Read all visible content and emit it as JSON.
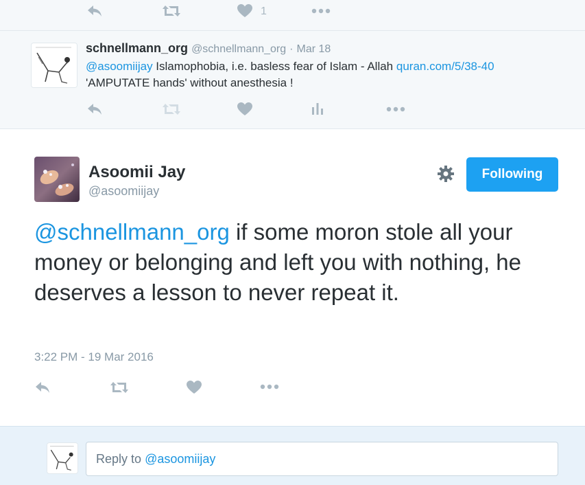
{
  "top_actions": {
    "like_count": "1"
  },
  "reply_tweet": {
    "name": "schnellmann_org",
    "handle": "@schnellmann_org",
    "separator": "·",
    "date": "Mar 18",
    "mention": "@asoomiijay",
    "text_part1": " Islamophobia, i.e. basless fear of Islam - Allah ",
    "link": "quran.com/5/38-40",
    "text_part2": "'AMPUTATE hands' without anesthesia !"
  },
  "main_tweet": {
    "name": "Asoomii Jay",
    "handle": "@asoomiijay",
    "follow_label": "Following",
    "mention": "@schnellmann_org",
    "text": " if some moron stole all your money or belonging and left you with nothing, he deserves a lesson to never repeat it.",
    "timestamp": "3:22 PM - 19 Mar 2016"
  },
  "reply_box": {
    "prefix": "Reply to ",
    "mention": "@asoomiijay"
  },
  "colors": {
    "accent": "#1da1f2",
    "link": "#1b95e0",
    "muted": "#8899a6",
    "icon": "#aab8c2"
  }
}
